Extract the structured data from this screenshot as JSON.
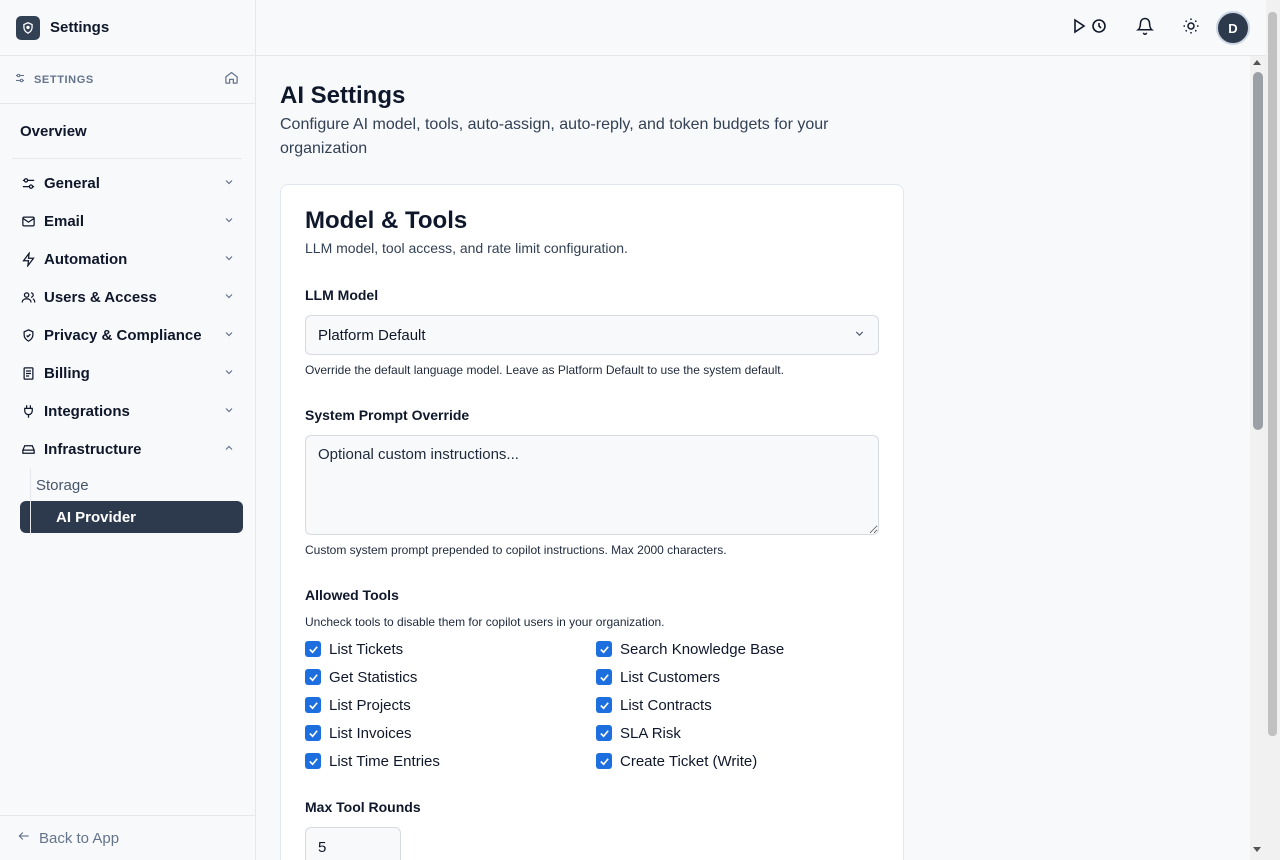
{
  "app": {
    "title": "Settings"
  },
  "sidebar": {
    "section_label": "SETTINGS",
    "overview": "Overview",
    "items": [
      {
        "label": "General",
        "icon": "sliders-icon",
        "expanded": false
      },
      {
        "label": "Email",
        "icon": "mail-icon",
        "expanded": false
      },
      {
        "label": "Automation",
        "icon": "zap-icon",
        "expanded": false
      },
      {
        "label": "Users & Access",
        "icon": "users-icon",
        "expanded": false
      },
      {
        "label": "Privacy & Compliance",
        "icon": "shield-check-icon",
        "expanded": false
      },
      {
        "label": "Billing",
        "icon": "receipt-icon",
        "expanded": false
      },
      {
        "label": "Integrations",
        "icon": "plug-icon",
        "expanded": false
      },
      {
        "label": "Infrastructure",
        "icon": "hard-drive-icon",
        "expanded": true
      }
    ],
    "sub_items": [
      {
        "label": "Storage",
        "active": false
      },
      {
        "label": "AI Provider",
        "active": true
      }
    ],
    "back_label": "Back to App"
  },
  "topbar": {
    "icons": [
      "play-timer-icon",
      "bell-icon",
      "sun-icon"
    ],
    "avatar_initial": "D"
  },
  "page": {
    "title": "AI Settings",
    "description": "Configure AI model, tools, auto-assign, auto-reply, and token budgets for your organization"
  },
  "model_tools": {
    "title": "Model & Tools",
    "description": "LLM model, tool access, and rate limit configuration.",
    "llm_model": {
      "label": "LLM Model",
      "value": "Platform Default",
      "help": "Override the default language model. Leave as Platform Default to use the system default."
    },
    "system_prompt": {
      "label": "System Prompt Override",
      "placeholder": "Optional custom instructions...",
      "help": "Custom system prompt prepended to copilot instructions. Max 2000 characters."
    },
    "allowed_tools": {
      "label": "Allowed Tools",
      "help": "Uncheck tools to disable them for copilot users in your organization.",
      "tools": [
        {
          "label": "List Tickets",
          "checked": true
        },
        {
          "label": "Search Knowledge Base",
          "checked": true
        },
        {
          "label": "Get Statistics",
          "checked": true
        },
        {
          "label": "List Customers",
          "checked": true
        },
        {
          "label": "List Projects",
          "checked": true
        },
        {
          "label": "List Contracts",
          "checked": true
        },
        {
          "label": "List Invoices",
          "checked": true
        },
        {
          "label": "SLA Risk",
          "checked": true
        },
        {
          "label": "List Time Entries",
          "checked": true
        },
        {
          "label": "Create Ticket (Write)",
          "checked": true
        }
      ]
    },
    "max_tool_rounds": {
      "label": "Max Tool Rounds",
      "value": "5"
    }
  },
  "colors": {
    "accent": "#1d6fe0",
    "active_nav": "#2d3a4e",
    "border": "#e5e7eb"
  }
}
